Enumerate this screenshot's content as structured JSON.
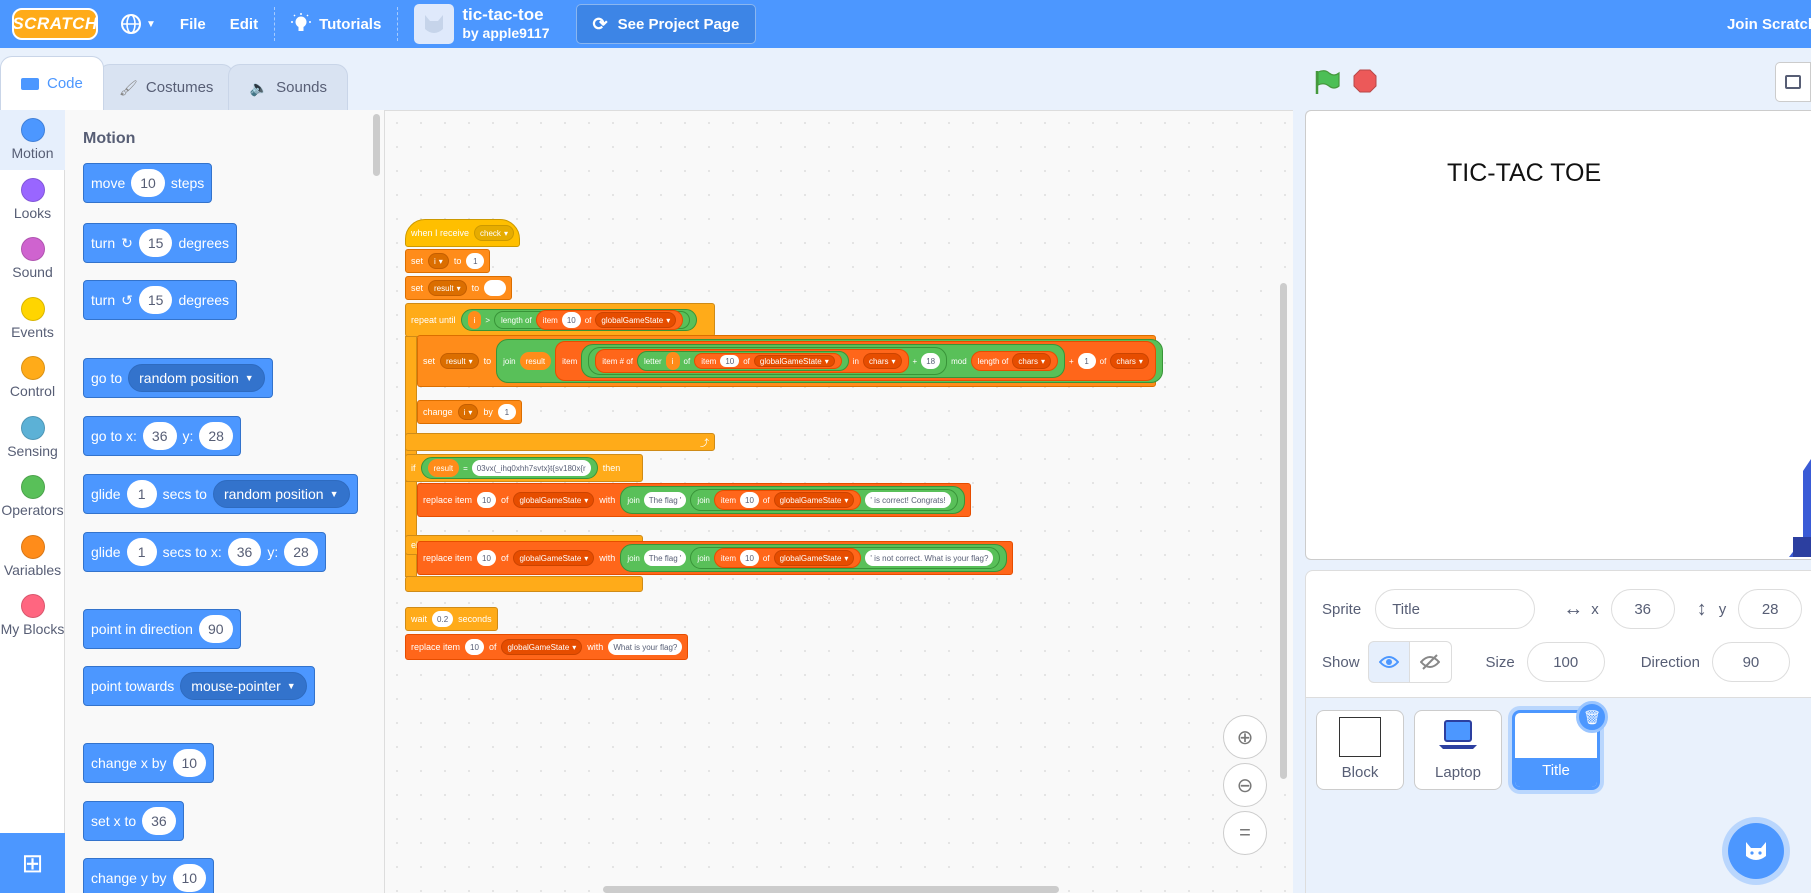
{
  "menubar": {
    "logo": "SCRATCH",
    "file": "File",
    "edit": "Edit",
    "tutorials": "Tutorials",
    "project_title": "tic-tac-toe",
    "project_author": "by apple9117",
    "see_project_page": "See Project Page",
    "join": "Join Scratch"
  },
  "tabs": [
    {
      "label": "Code",
      "icon": "code-icon",
      "active": true
    },
    {
      "label": "Costumes",
      "icon": "brush-icon",
      "active": false
    },
    {
      "label": "Sounds",
      "icon": "speaker-icon",
      "active": false
    }
  ],
  "categories": [
    {
      "label": "Motion",
      "color": "#4c97ff"
    },
    {
      "label": "Looks",
      "color": "#9966ff"
    },
    {
      "label": "Sound",
      "color": "#cf63cf"
    },
    {
      "label": "Events",
      "color": "#ffd500"
    },
    {
      "label": "Control",
      "color": "#ffab19"
    },
    {
      "label": "Sensing",
      "color": "#5cb1d6"
    },
    {
      "label": "Operators",
      "color": "#59c059"
    },
    {
      "label": "Variables",
      "color": "#ff8c1a"
    },
    {
      "label": "My Blocks",
      "color": "#ff6680"
    }
  ],
  "flyout": {
    "title": "Motion",
    "move": {
      "a": "move",
      "v": "10",
      "b": "steps"
    },
    "turn_right": {
      "a": "turn",
      "v": "15",
      "b": "degrees"
    },
    "turn_left": {
      "a": "turn",
      "v": "15",
      "b": "degrees"
    },
    "goto": {
      "a": "go to",
      "d": "random position"
    },
    "gotoxy": {
      "a": "go to x:",
      "x": "36",
      "b": "y:",
      "y": "28"
    },
    "glide": {
      "a": "glide",
      "v": "1",
      "b": "secs to",
      "d": "random position"
    },
    "glidexy": {
      "a": "glide",
      "v": "1",
      "b": "secs to x:",
      "x": "36",
      "c": "y:",
      "y": "28"
    },
    "point_dir": {
      "a": "point in direction",
      "v": "90"
    },
    "point_towards": {
      "a": "point towards",
      "d": "mouse-pointer"
    },
    "change_x": {
      "a": "change x by",
      "v": "10"
    },
    "set_x": {
      "a": "set x to",
      "v": "36"
    },
    "change_y": {
      "a": "change y by",
      "v": "10"
    }
  },
  "script": {
    "when_receive": "when I receive",
    "msg_check": "check",
    "set": "set",
    "to": "to",
    "var_i": "i",
    "one": "1",
    "var_result": "result",
    "repeat_until": "repeat until",
    "gt": ">",
    "length_of": "length of",
    "item": "item",
    "ten": "10",
    "of": "of",
    "list_gs": "globalGameState",
    "join": "join",
    "item_num_of": "item # of",
    "letter": "letter",
    "in": "in",
    "chars": "chars",
    "plus": "+",
    "eighteen": "18",
    "mod": "mod",
    "change": "change",
    "by": "by",
    "if": "if",
    "eq": "=",
    "cipher": "03vx(_ihq0xhh7svtx}t{sv180x{r",
    "then": "then",
    "replace_item": "replace item",
    "with": "with",
    "the_flag": "The flag '",
    "correct": "' is correct! Congrats!",
    "else": "else",
    "not_correct": "' is not correct. What is your flag?",
    "wait": "wait",
    "wait_secs": "0.2",
    "seconds": "seconds",
    "what_flag": "What is your flag?"
  },
  "stage": {
    "title_text": "TIC-TAC TOE"
  },
  "sprite_info": {
    "sprite_label": "Sprite",
    "sprite_name": "Title",
    "x_label": "x",
    "x": "36",
    "y_label": "y",
    "y": "28",
    "show_label": "Show",
    "size_label": "Size",
    "size": "100",
    "direction_label": "Direction",
    "direction": "90"
  },
  "sprites": [
    {
      "name": "Block",
      "selected": false
    },
    {
      "name": "Laptop",
      "selected": false
    },
    {
      "name": "Title",
      "selected": true
    }
  ]
}
